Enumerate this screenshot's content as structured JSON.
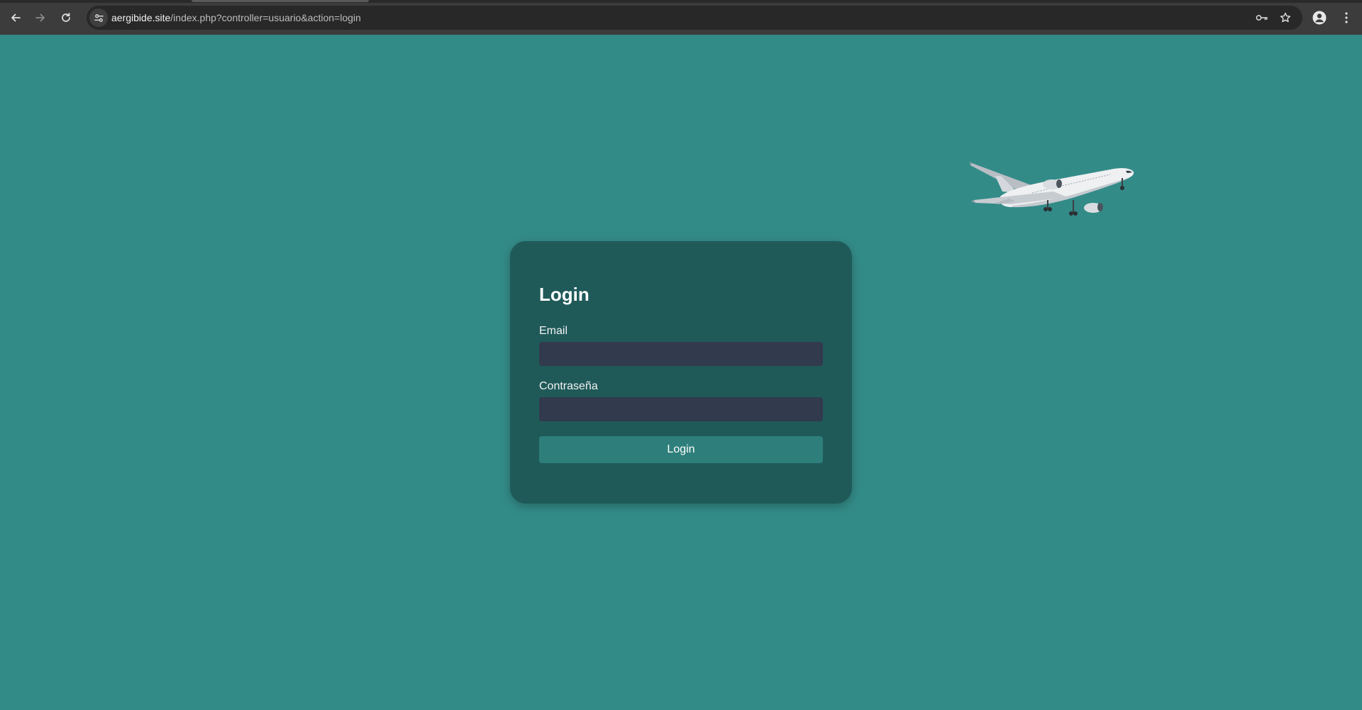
{
  "browser": {
    "url_host": "aergibide.site",
    "url_path": "/index.php?controller=usuario&action=login",
    "icons": {
      "back": "arrow-left-icon",
      "forward": "arrow-right-icon",
      "reload": "reload-icon",
      "site_info": "tune-icon",
      "password": "key-icon",
      "bookmark": "star-icon",
      "profile": "profile-icon",
      "menu": "kebab-menu-icon"
    }
  },
  "colors": {
    "page_background": "#338b88",
    "card_background": "#1f5a59",
    "input_background": "#323a4e",
    "button_background": "#2e7f7b"
  },
  "decoration": {
    "image": "airplane"
  },
  "login": {
    "title": "Login",
    "email_label": "Email",
    "email_value": "",
    "password_label": "Contraseña",
    "password_value": "",
    "submit_label": "Login"
  }
}
